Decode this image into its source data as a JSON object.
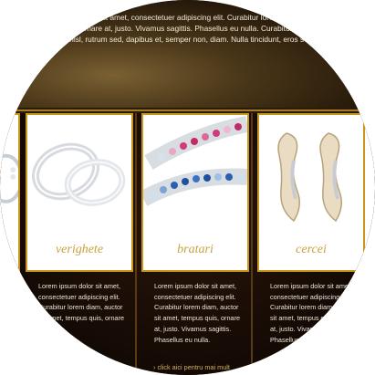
{
  "hero": {
    "lines": [
      "Lorem ipsum dolor sit amet, consectetuer adipiscing elit. Curabitur lorem diam, auctor sit amet,",
      "tempus quis, ornare at, justo. Vivamus sagittis. Phasellus eu nulla. Curabitur dolor, pulvinar nec, tempus ut, volutpat et, leo. Donec turpis erat,",
      "Sed dolor nisl, rutrum sed, dapibus et, semper non, diam. Nulla tincidunt, eros sed condimentum tincidunt, risus arcu aliquet eros, sed imperdiet lacus nisi eget,"
    ]
  },
  "products": [
    {
      "label": ""
    },
    {
      "label": "verighete",
      "desc": [
        "Lorem ipsum dolor sit amet,",
        "consectetuer adipiscing elit.",
        "Curabitur lorem diam, auctor",
        "sit amet, tempus quis, ornare"
      ]
    },
    {
      "label": "bratari",
      "desc": [
        "Lorem ipsum dolor sit amet,",
        "consectetuer adipiscing elit.",
        "Curabitur lorem diam, auctor",
        "sit amet, tempus quis, ornare",
        "at, justo. Vivamus sagittis.",
        "Phasellus eu nulla."
      ]
    },
    {
      "label": "cercei",
      "desc": [
        "Lorem ipsum dolor sit amet,",
        "consectetuer adipiscing elit.",
        "Curabitur lorem diam,",
        "sit amet, tempus quis, ornare",
        "at, justo. Vivamus sagittis.",
        "Phasellus eu nulla."
      ]
    },
    {
      "label": ""
    }
  ],
  "more_link": "click aici pentru mai mult"
}
